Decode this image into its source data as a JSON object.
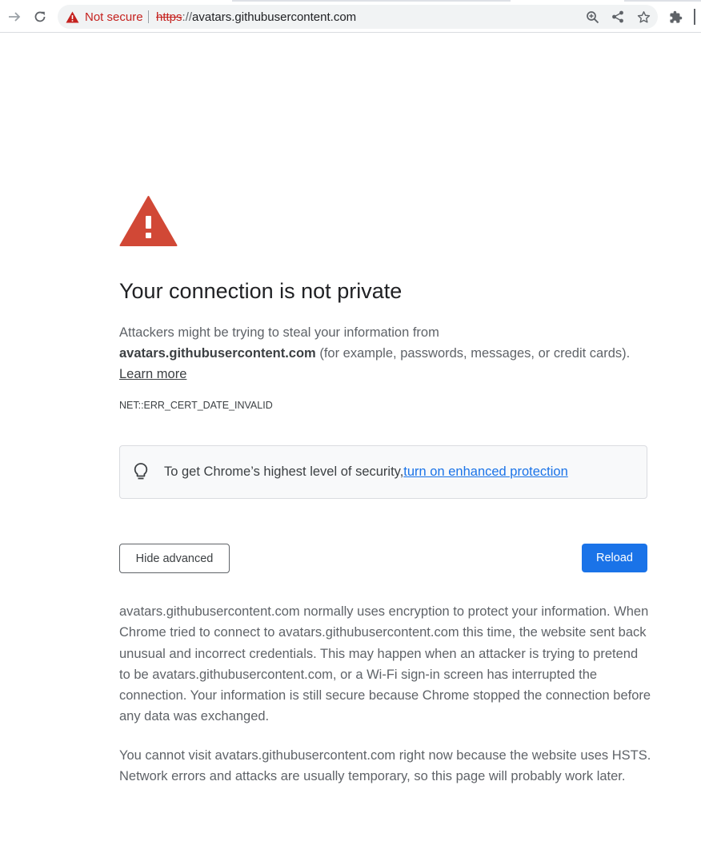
{
  "toolbar": {
    "forward_icon": "arrow-right-icon",
    "reload_icon": "reload-icon",
    "security_icon": "warning-triangle-icon",
    "security_label": "Not secure",
    "url_scheme": "https",
    "url_separator": "://",
    "url_host": "avatars.githubusercontent.com",
    "zoom_icon": "zoom-in-icon",
    "share_icon": "share-icon",
    "bookmark_icon": "star-icon",
    "extensions_icon": "puzzle-icon"
  },
  "interstitial": {
    "heading": "Your connection is not private",
    "intro_prefix": "Attackers might be trying to steal your information from ",
    "intro_host": "avatars.githubusercontent.com",
    "intro_suffix": " (for example, passwords, messages, or credit cards). ",
    "learn_more": "Learn more",
    "error_code": "NET::ERR_CERT_DATE_INVALID",
    "enhanced_text": "To get Chrome’s highest level of security, ",
    "enhanced_link": "turn on enhanced protection",
    "hide_advanced_button": "Hide advanced",
    "reload_button": "Reload",
    "details_paragraph_1": "avatars.githubusercontent.com normally uses encryption to protect your information. When Chrome tried to connect to avatars.githubusercontent.com this time, the website sent back unusual and incorrect credentials. This may happen when an attacker is trying to pretend to be avatars.githubusercontent.com, or a Wi-Fi sign-in screen has interrupted the connection. Your information is still secure because Chrome stopped the connection before any data was exchanged.",
    "details_paragraph_2": "You cannot visit avatars.githubusercontent.com right now because the website uses HSTS. Network errors and attacks are usually temporary, so this page will probably work later."
  },
  "colors": {
    "warning_red": "#c5221f",
    "icon_red": "#d14836",
    "accent_blue": "#1a73e8"
  }
}
